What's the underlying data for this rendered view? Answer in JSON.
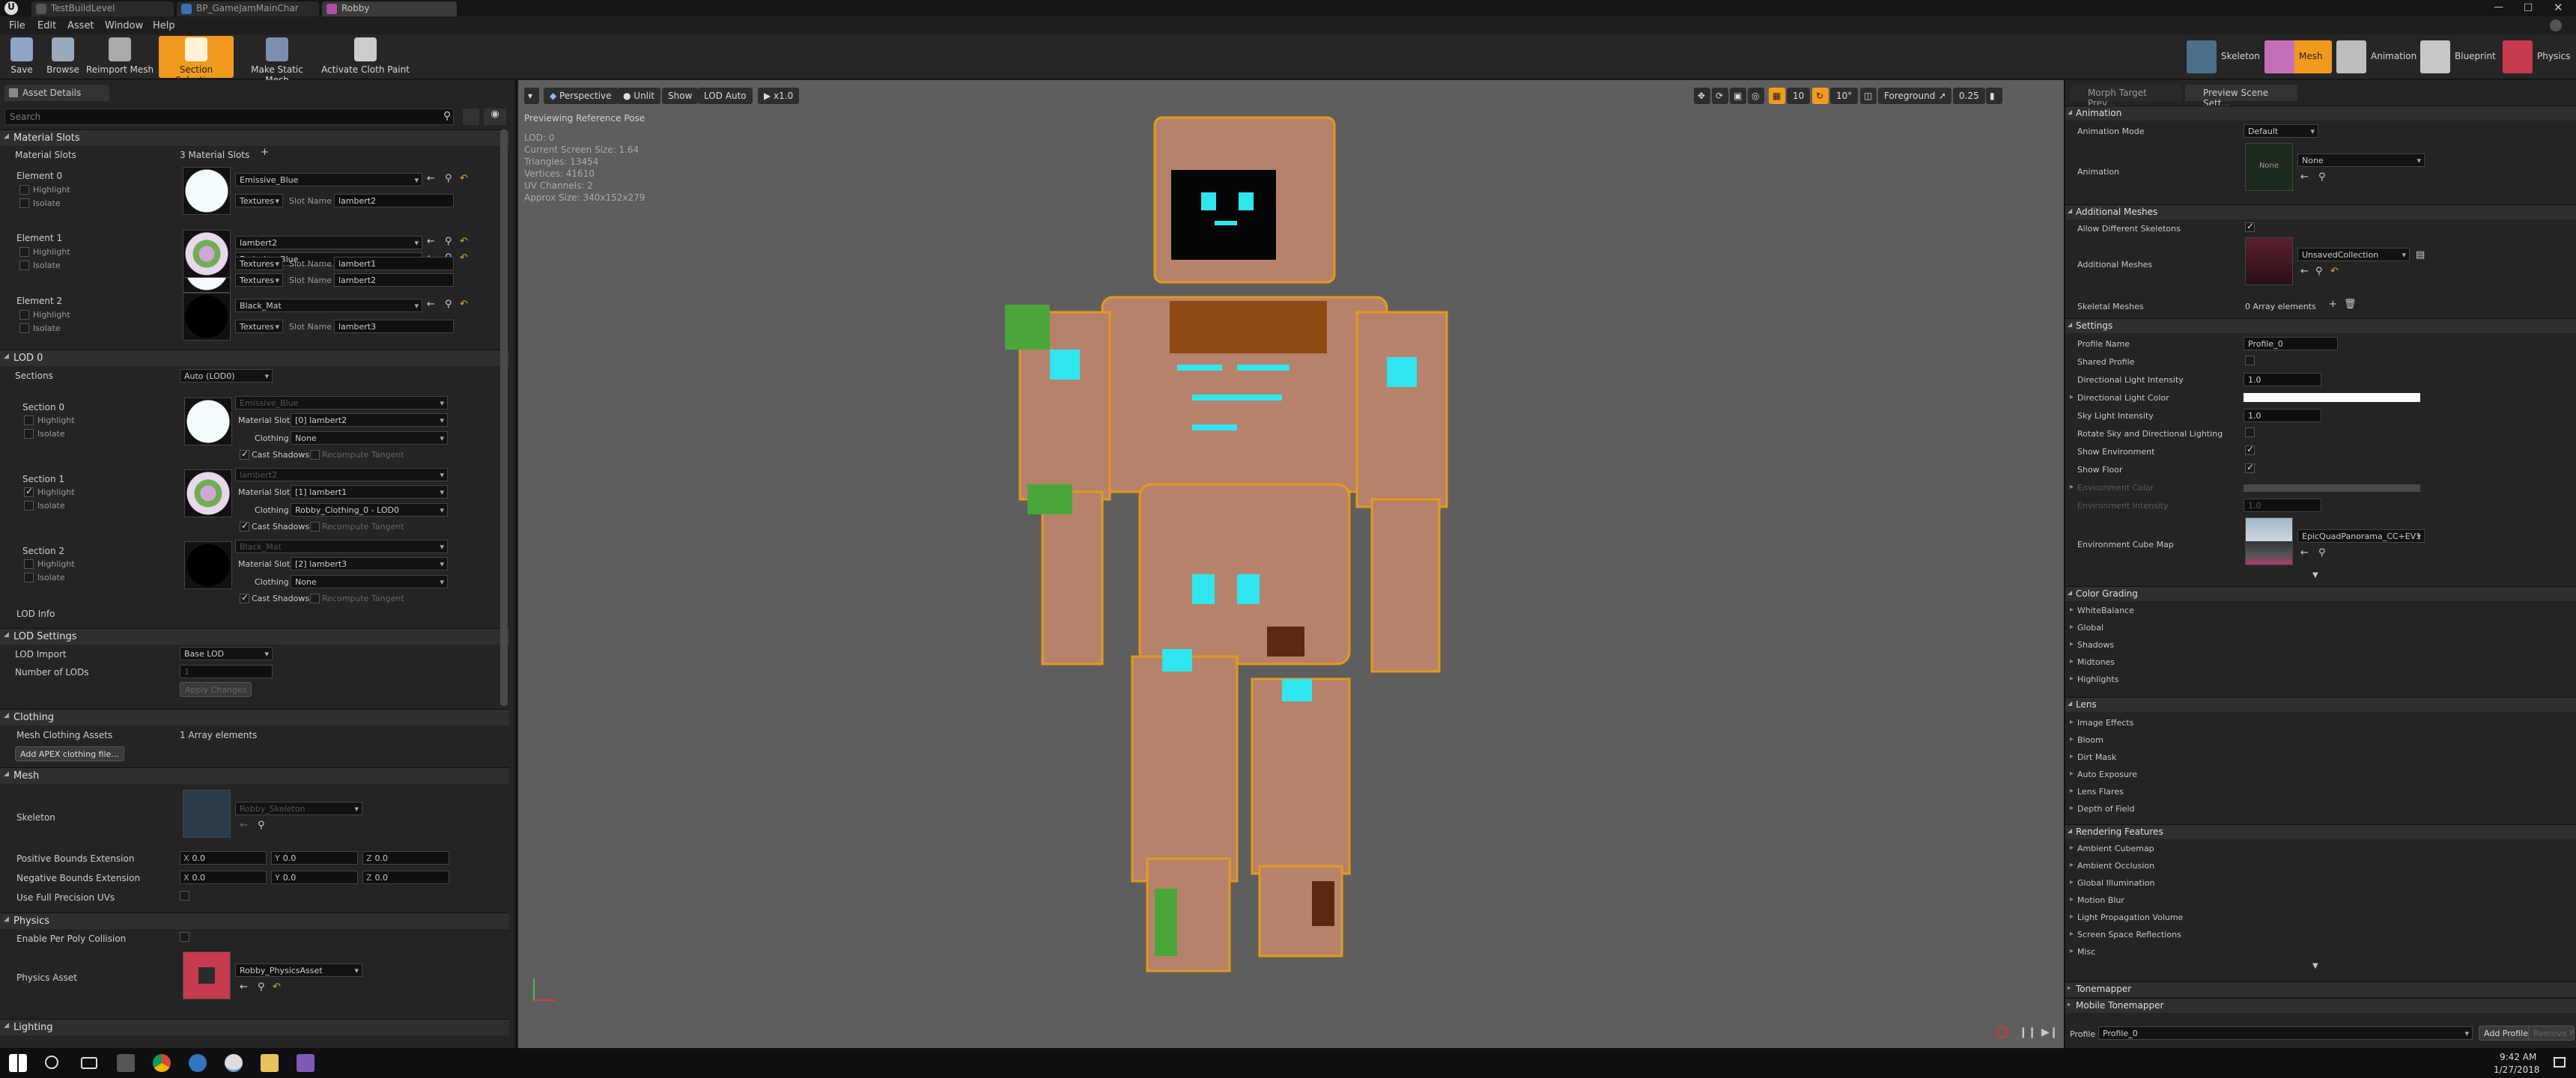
{
  "titlebar": {
    "tabs": [
      "TestBuildLevel",
      "BP_GameJamMainChar",
      "Robby"
    ]
  },
  "menu": [
    "File",
    "Edit",
    "Asset",
    "Window",
    "Help"
  ],
  "toolbar": {
    "buttons": [
      "Save",
      "Browse",
      "Reimport Mesh",
      "Section Selection",
      "Make Static Mesh",
      "Activate Cloth Paint"
    ],
    "modes": [
      "Skeleton",
      "Mesh",
      "Animation",
      "Blueprint",
      "Physics"
    ],
    "accent_color": "#f29a1d"
  },
  "left_panel": {
    "tab": "Asset Details",
    "search_placeholder": "Search",
    "material_slots": {
      "header": "Material Slots",
      "label": "Material Slots",
      "count": "3 Material Slots",
      "elements": [
        {
          "name": "Element 0",
          "material": "Emissive_Blue",
          "slot": "lambert2"
        },
        {
          "name": "Element 1",
          "material": "lambert2",
          "slot": "lambert1"
        },
        {
          "name": "Element 2",
          "material": "Black_Mat",
          "slot": "lambert3"
        }
      ],
      "highlight": "Highlight",
      "isolate": "Isolate",
      "textures": "Textures",
      "slot_name": "Slot Name"
    },
    "lod0": {
      "header": "LOD 0",
      "sections_label": "Sections",
      "lod_combo": "Auto (LOD0)",
      "sections": [
        {
          "name": "Section 0",
          "material": "Emissive_Blue",
          "slot": "[0] lambert2",
          "clothing": "None"
        },
        {
          "name": "Section 1",
          "material": "lambert2",
          "slot": "[1] lambert1",
          "clothing": "Robby_Clothing_0 - LOD0"
        },
        {
          "name": "Section 2",
          "material": "Black_Mat",
          "slot": "[2] lambert3",
          "clothing": "None"
        }
      ],
      "material_slot": "Material Slot",
      "clothing": "Clothing",
      "cast_shadows": "Cast Shadows",
      "recompute_tangent": "Recompute Tangent",
      "lod_info": "LOD Info"
    },
    "lod_settings": {
      "header": "LOD Settings",
      "lod_import": "LOD Import",
      "lod_import_value": "Base LOD",
      "number_of_lods": "Number of LODs",
      "number_value": "1",
      "apply": "Apply Changes"
    },
    "clothing": {
      "header": "Clothing",
      "assets_label": "Mesh Clothing Assets",
      "assets_value": "1 Array elements",
      "add_button": "Add APEX clothing file..."
    },
    "mesh": {
      "header": "Mesh",
      "skeleton_label": "Skeleton",
      "skeleton_value": "Robby_Skeleton",
      "pos_bounds": "Positive Bounds Extension",
      "neg_bounds": "Negative Bounds Extension",
      "full_precision": "Use Full Precision UVs",
      "x": "X",
      "y": "Y",
      "z": "Z",
      "zero": "0.0"
    },
    "physics": {
      "header": "Physics",
      "per_poly": "Enable Per Poly Collision",
      "asset_label": "Physics Asset",
      "asset_value": "Robby_PhysicsAsset"
    },
    "lighting": {
      "header": "Lighting"
    }
  },
  "viewport": {
    "buttons": [
      "Perspective",
      "Unlit",
      "Show",
      "LOD Auto",
      "x1.0"
    ],
    "right_buttons": [
      "10",
      "10°",
      "Foreground",
      "0.25"
    ],
    "previewing": "Previewing Reference Pose",
    "info": [
      "LOD: 0",
      "Current Screen Size: 1.64",
      "Triangles: 13454",
      "Vertices: 41610",
      "UV Channels: 2",
      "Approx Size: 340x152x279"
    ],
    "bg_color": "#5e5e5e"
  },
  "right_panel": {
    "tabs": [
      "Morph Target Prev...",
      "Preview Scene Sett..."
    ],
    "animation": {
      "header": "Animation",
      "mode_label": "Animation Mode",
      "mode_value": "Default",
      "anim_label": "Animation",
      "anim_value": "None",
      "thumb_text": "None"
    },
    "additional_meshes": {
      "header": "Additional Meshes",
      "allow_label": "Allow Different Skeletons",
      "meshes_label": "Additional Meshes",
      "meshes_value": "UnsavedCollection",
      "skeletal_label": "Skeletal Meshes",
      "skeletal_value": "0 Array elements"
    },
    "settings": {
      "header": "Settings",
      "rows": [
        "Profile Name",
        "Shared Profile",
        "Directional Light Intensity",
        "Directional Light Color",
        "Sky Light Intensity",
        "Rotate Sky and Directional Lighting",
        "Show Environment",
        "Show Floor",
        "Environment Color",
        "Environment Intensity",
        "Environment Cube Map"
      ],
      "profile_name": "Profile_0",
      "dir_intensity": "1.0",
      "sky_intensity": "1.0",
      "env_intensity": "1.0",
      "cube_map": "EpicQuadPanorama_CC+EV1"
    },
    "color_grading": {
      "header": "Color Grading",
      "rows": [
        "WhiteBalance",
        "Global",
        "Shadows",
        "Midtones",
        "Highlights"
      ]
    },
    "lens": {
      "header": "Lens",
      "rows": [
        "Image Effects",
        "Bloom",
        "Dirt Mask",
        "Auto Exposure",
        "Lens Flares",
        "Depth of Field"
      ]
    },
    "rendering": {
      "header": "Rendering Features",
      "rows": [
        "Ambient Cubemap",
        "Ambient Occlusion",
        "Global Illumination",
        "Motion Blur",
        "Light Propagation Volume",
        "Screen Space Reflections",
        "Misc"
      ]
    },
    "tonemapper": "Tonemapper",
    "mobile_tonemapper": "Mobile Tonemapper",
    "profile_label": "Profile",
    "profile_value": "Profile_0",
    "add_profile": "Add Profile",
    "remove_profile": "Remove Profile"
  },
  "taskbar": {
    "time": "9:42 AM",
    "date": "1/27/2018"
  }
}
